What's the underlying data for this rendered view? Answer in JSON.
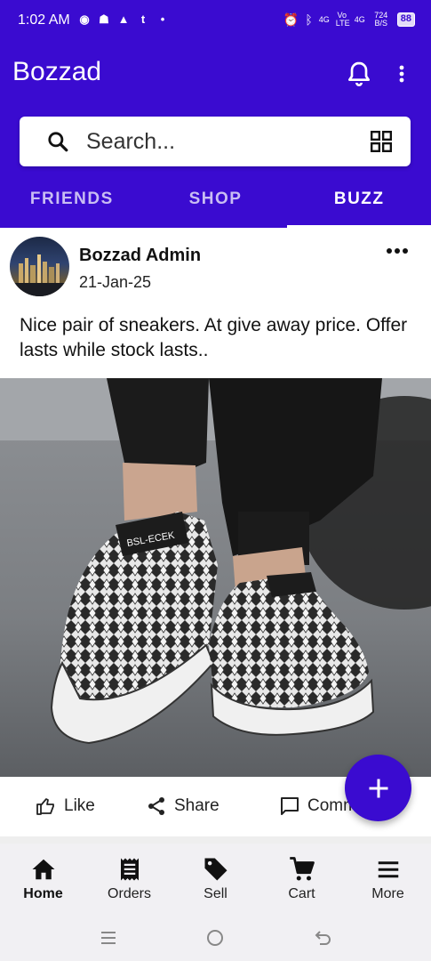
{
  "status_bar": {
    "time": "1:02 AM",
    "network_1": "4G",
    "volte": "Vo LTE",
    "network_2": "4G",
    "speed": "724 B/S",
    "battery": "88"
  },
  "app_bar": {
    "title": "Bozzad"
  },
  "search": {
    "placeholder": "Search..."
  },
  "tabs": [
    {
      "label": "FRIENDS"
    },
    {
      "label": "SHOP"
    },
    {
      "label": "BUZZ",
      "active": true
    }
  ],
  "post": {
    "author": "Bozzad Admin",
    "date": "21-Jan-25",
    "text": "Nice pair of sneakers. At give away price. Offer lasts while stock lasts..",
    "sneaker_brand_text": "BSL-ECEK",
    "actions": {
      "like": "Like",
      "share": "Share",
      "comment": "Comm"
    }
  },
  "bottom_nav": [
    {
      "label": "Home",
      "icon": "home-icon",
      "active": true
    },
    {
      "label": "Orders",
      "icon": "receipt-icon"
    },
    {
      "label": "Sell",
      "icon": "tag-icon"
    },
    {
      "label": "Cart",
      "icon": "cart-icon"
    },
    {
      "label": "More",
      "icon": "menu-icon"
    }
  ],
  "colors": {
    "primary": "#3a0bd0",
    "nav_background": "#f1f0f3"
  }
}
